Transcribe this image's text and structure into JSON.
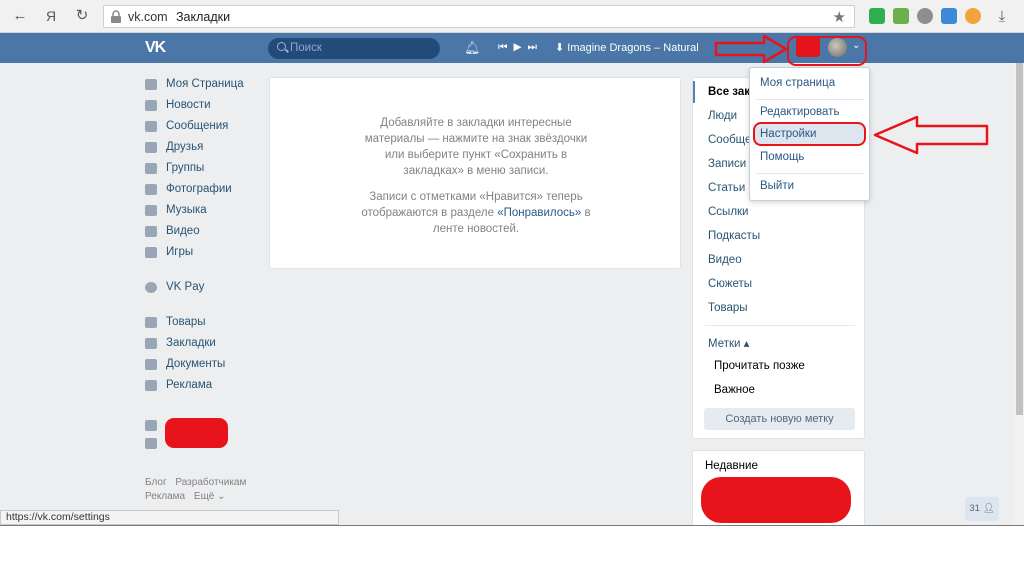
{
  "browser": {
    "host": "vk.com",
    "page_title": "Закладки",
    "yandex_label": "Я"
  },
  "header": {
    "search_placeholder": "Поиск",
    "track": "Imagine Dragons – Natural"
  },
  "left_menu": {
    "items": [
      {
        "label": "Моя Страница",
        "icon": "home-icon"
      },
      {
        "label": "Новости",
        "icon": "news-icon"
      },
      {
        "label": "Сообщения",
        "icon": "messages-icon"
      },
      {
        "label": "Друзья",
        "icon": "friends-icon"
      },
      {
        "label": "Группы",
        "icon": "groups-icon"
      },
      {
        "label": "Фотографии",
        "icon": "photo-icon"
      },
      {
        "label": "Музыка",
        "icon": "music-icon"
      },
      {
        "label": "Видео",
        "icon": "video-icon"
      },
      {
        "label": "Игры",
        "icon": "games-icon"
      },
      {
        "label": "VK Pay",
        "icon": "vkpay-icon"
      },
      {
        "label": "Товары",
        "icon": "goods-icon"
      },
      {
        "label": "Закладки",
        "icon": "bookmark-star-icon"
      },
      {
        "label": "Документы",
        "icon": "documents-icon"
      },
      {
        "label": "Реклама",
        "icon": "ads-icon"
      }
    ],
    "footer": [
      "Блог",
      "Разработчикам",
      "Реклама",
      "Ещё ⌄"
    ]
  },
  "empty_state": {
    "line1": "Добавляйте в закладки интересные материалы — нажмите на знак звёздочки или выберите пункт «Сохранить в закладках» в меню записи.",
    "line2_prefix": "Записи с отметками «Нравится» теперь отображаются в разделе ",
    "line2_link": "«Понравилось»",
    "line2_suffix": " в ленте новостей."
  },
  "filters": {
    "items": [
      "Все закладки",
      "Люди",
      "Сообщества",
      "Записи",
      "Статьи",
      "Ссылки",
      "Подкасты",
      "Видео",
      "Сюжеты",
      "Товары"
    ],
    "tags_title": "Метки ▴",
    "tags": [
      "Прочитать позже",
      "Важное"
    ],
    "create_tag_button": "Создать новую метку"
  },
  "recent": {
    "title": "Недавние"
  },
  "dropdown": {
    "my_page": "Моя страница",
    "edit": "Редактировать",
    "settings": "Настройки",
    "help": "Помощь",
    "logout": "Выйти"
  },
  "status_bar": "https://vk.com/settings",
  "chat_badge": "31",
  "colors": {
    "vk_blue": "#4a76a8",
    "annotation_red": "#e8141b",
    "link": "#2a5885"
  }
}
